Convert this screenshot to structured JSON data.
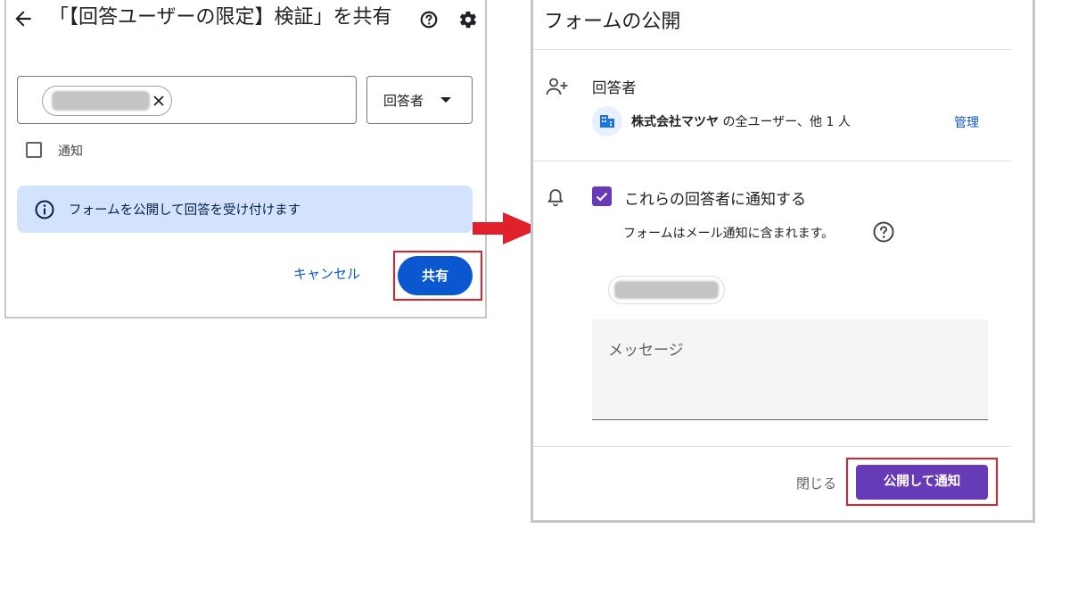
{
  "share_dialog": {
    "title": "「【回答ユーザーの限定】検証」を共有",
    "role_label": "回答者",
    "notify_label": "通知",
    "info_text": "フォームを公開して回答を受け付けます",
    "cancel_label": "キャンセル",
    "share_label": "共有"
  },
  "publish_dialog": {
    "title": "フォームの公開",
    "responders_label": "回答者",
    "domain_name": "株式会社マツヤ",
    "domain_suffix": " の全ユーザー、他 1 人",
    "manage_label": "管理",
    "notify_checkbox_label": "これらの回答者に通知する",
    "mail_note": "フォームはメール通知に含まれます。",
    "message_placeholder": "メッセージ",
    "close_label": "閉じる",
    "publish_label": "公開して通知",
    "notify_checked": true
  },
  "colors": {
    "primary_blue": "#0b57d0",
    "info_banner_bg": "#d3e3fd",
    "purple": "#673ab7",
    "highlight_red": "#e0202b",
    "arrow_red": "#e0202b"
  },
  "icons": {
    "back": "arrow-left-icon",
    "help": "help-icon",
    "settings": "gear-icon",
    "chip_remove": "close-icon",
    "dropdown": "caret-down-icon",
    "info": "info-icon",
    "person_add": "person-add-icon",
    "domain": "building-icon",
    "bell": "bell-icon",
    "check": "check-icon"
  }
}
